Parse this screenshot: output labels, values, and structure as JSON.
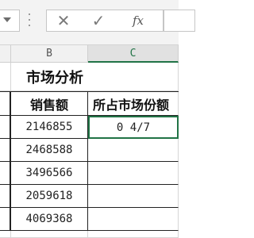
{
  "formula_bar": {
    "cancel_icon": "✕",
    "enter_icon": "✓",
    "fx_label": "fx"
  },
  "columns": [
    "",
    "B",
    "C"
  ],
  "sheet": {
    "title": "市场分析",
    "header": {
      "sales": "销售额",
      "share": "所占市场份额"
    },
    "rows": [
      {
        "sales": "2146855",
        "share": "0 4/7"
      },
      {
        "sales": "2468588",
        "share": ""
      },
      {
        "sales": "3496566",
        "share": ""
      },
      {
        "sales": "2059618",
        "share": ""
      },
      {
        "sales": "4069368",
        "share": ""
      }
    ]
  },
  "colors": {
    "accent": "#217346",
    "grid": "#d6d6d6",
    "border": "#222222"
  }
}
